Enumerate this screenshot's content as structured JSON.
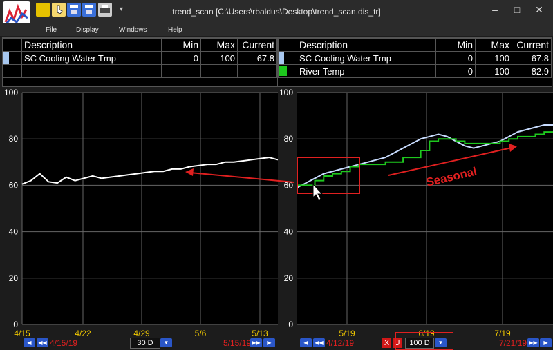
{
  "window": {
    "title": "trend_scan [C:\\Users\\rbaldus\\Desktop\\trend_scan.dis_tr]"
  },
  "menu": [
    "File",
    "Display",
    "Windows",
    "Help"
  ],
  "left_table": {
    "headers": [
      "Description",
      "Min",
      "Max",
      "Current"
    ],
    "rows": [
      {
        "desc": "SC Cooling Water Tmp",
        "min": "0",
        "max": "100",
        "current": "67.8",
        "color": "#a8c8f0"
      }
    ]
  },
  "right_table": {
    "headers": [
      "Description",
      "Min",
      "Max",
      "Current"
    ],
    "rows": [
      {
        "desc": "SC Cooling Water Tmp",
        "min": "0",
        "max": "100",
        "current": "67.8",
        "color": "#a8c8f0"
      },
      {
        "desc": "River Temp",
        "min": "0",
        "max": "100",
        "current": "82.9",
        "color": "#1ec81e"
      }
    ]
  },
  "left_chart": {
    "y_ticks": [
      "100",
      "80",
      "60",
      "40",
      "20",
      "0"
    ],
    "x_ticks": [
      "4/15",
      "4/22",
      "4/29",
      "5/6",
      "5/13"
    ],
    "start_date": "4/15/19",
    "end_date": "5/15/19",
    "span": "30 D"
  },
  "right_chart": {
    "y_ticks": [
      "100",
      "80",
      "60",
      "40",
      "20",
      "0"
    ],
    "x_ticks": [
      "5/19",
      "6/19",
      "7/19"
    ],
    "start_date": "4/12/19",
    "end_date": "7/21/19",
    "span": "100 D",
    "annotation": "Seasonal",
    "x_button": "X",
    "u_button": "U"
  },
  "chart_data": [
    {
      "type": "line",
      "ylim": [
        0,
        100
      ],
      "x_ticks": [
        "4/15",
        "4/22",
        "4/29",
        "5/6",
        "5/13"
      ],
      "series": [
        {
          "name": "SC Cooling Water Tmp",
          "color": "#ffffff",
          "values": [
            60.5,
            62,
            65,
            61.5,
            61,
            63.5,
            62,
            63,
            64,
            63,
            63.5,
            64,
            64.5,
            65,
            65.5,
            66,
            66,
            67,
            67,
            68,
            68.5,
            69,
            69,
            70,
            70,
            70.5,
            71,
            71.5,
            72,
            71
          ]
        }
      ]
    },
    {
      "type": "line",
      "ylim": [
        0,
        100
      ],
      "x_ticks": [
        "5/19",
        "6/19",
        "7/19"
      ],
      "series": [
        {
          "name": "SC Cooling Water Tmp",
          "color": "#c8dcff",
          "values": [
            59,
            61,
            63,
            65,
            66,
            67,
            68,
            69,
            70,
            71,
            72,
            74,
            76,
            78,
            80,
            81,
            82,
            81,
            79,
            77,
            76,
            77,
            78,
            79,
            81,
            83,
            84,
            85,
            86,
            86
          ]
        },
        {
          "name": "River Temp",
          "color": "#1ec81e",
          "values": [
            60,
            60,
            62,
            64,
            65,
            66,
            68,
            69,
            69,
            69,
            70,
            70,
            72,
            72,
            75,
            79,
            80,
            80,
            79,
            78,
            78,
            78,
            78,
            79,
            80,
            81,
            81,
            82,
            83,
            83
          ]
        }
      ]
    }
  ]
}
